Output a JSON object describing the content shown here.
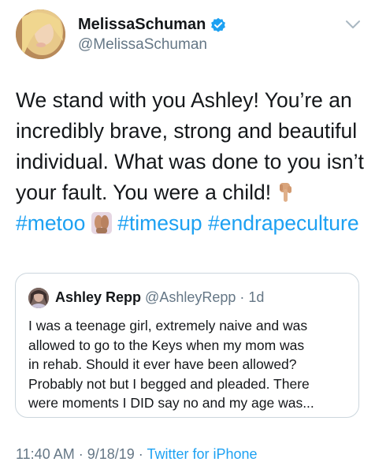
{
  "author": {
    "display_name": "MelissaSchuman",
    "handle": "@MelissaSchuman",
    "verified": true
  },
  "tweet": {
    "lines": [
      "We stand with you Ashley! You’re an",
      "incredibly brave, strong and beautiful",
      "individual. What was done to you isn’t",
      "your fault. You were a child!"
    ],
    "hashtags": [
      "#metoo",
      "#timesup",
      "#endrapeculture"
    ],
    "emojis": [
      "backhand-index-pointing-down-emoji",
      "raising-hands-emoji"
    ]
  },
  "quoted_tweet": {
    "name": "Ashley Repp",
    "handle_time": "@AshleyRepp · 1d",
    "lines": [
      "I was a teenage girl, extremely naive and was",
      "allowed to go to the Keys when my mom was",
      "in rehab. Should it ever have been allowed?",
      "Probably not but I begged and pleaded. There",
      "were moments I DID say no and my age was..."
    ]
  },
  "footer": {
    "timestamp": "11:40 AM · 9/18/19 ·",
    "source": "Twitter for iPhone"
  },
  "colors": {
    "link": "#1da1f2",
    "secondary_text": "#657786",
    "border": "#ccd6dd",
    "primary_text": "#14171a"
  }
}
